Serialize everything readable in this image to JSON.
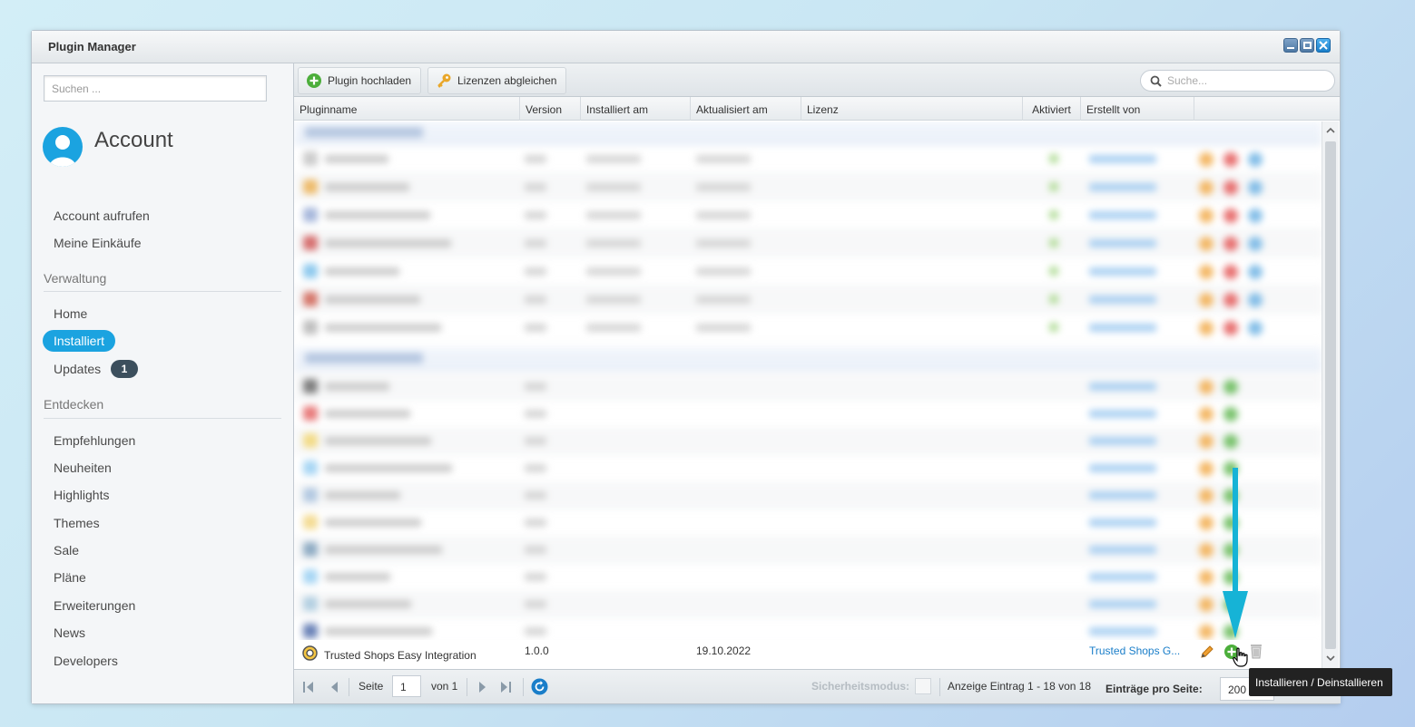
{
  "window": {
    "title": "Plugin Manager"
  },
  "sidebar": {
    "search_placeholder": "Suchen ...",
    "account_title": "Account",
    "account_items": [
      "Account aufrufen",
      "Meine Einkäufe"
    ],
    "verwaltung_title": "Verwaltung",
    "verwaltung_items": [
      "Home",
      "Installiert",
      "Updates"
    ],
    "updates_badge": "1",
    "entdecken_title": "Entdecken",
    "entdecken_items": [
      "Empfehlungen",
      "Neuheiten",
      "Highlights",
      "Themes",
      "Sale",
      "Pläne",
      "Erweiterungen",
      "News",
      "Developers"
    ]
  },
  "toolbar": {
    "upload_label": "Plugin hochladen",
    "licenses_label": "Lizenzen abgleichen",
    "search_placeholder": "Suche..."
  },
  "table": {
    "columns": [
      "Pluginname",
      "Version",
      "Installiert am",
      "Aktualisiert am",
      "Lizenz",
      "Aktiviert",
      "Erstellt von"
    ],
    "visible_row": {
      "name": "Trusted Shops Easy Integration",
      "version": "1.0.0",
      "installed": "",
      "updated": "19.10.2022",
      "license": "",
      "author": "Trusted Shops G..."
    }
  },
  "pager": {
    "page_label": "Seite",
    "page_value": "1",
    "of_label": "von 1",
    "safe_mode_label": "Sicherheitsmodus:",
    "display_info": "Anzeige Eintrag 1 - 18 von 18",
    "per_page_label": "Einträge pro Seite:",
    "per_page_value": "200"
  },
  "tooltip": {
    "text": "Installieren / Deinstallieren"
  },
  "colors": {
    "accent": "#1ba3e0",
    "badge": "#3c4f5d",
    "link": "#1a7ec9",
    "arrow": "#16b3d6"
  }
}
